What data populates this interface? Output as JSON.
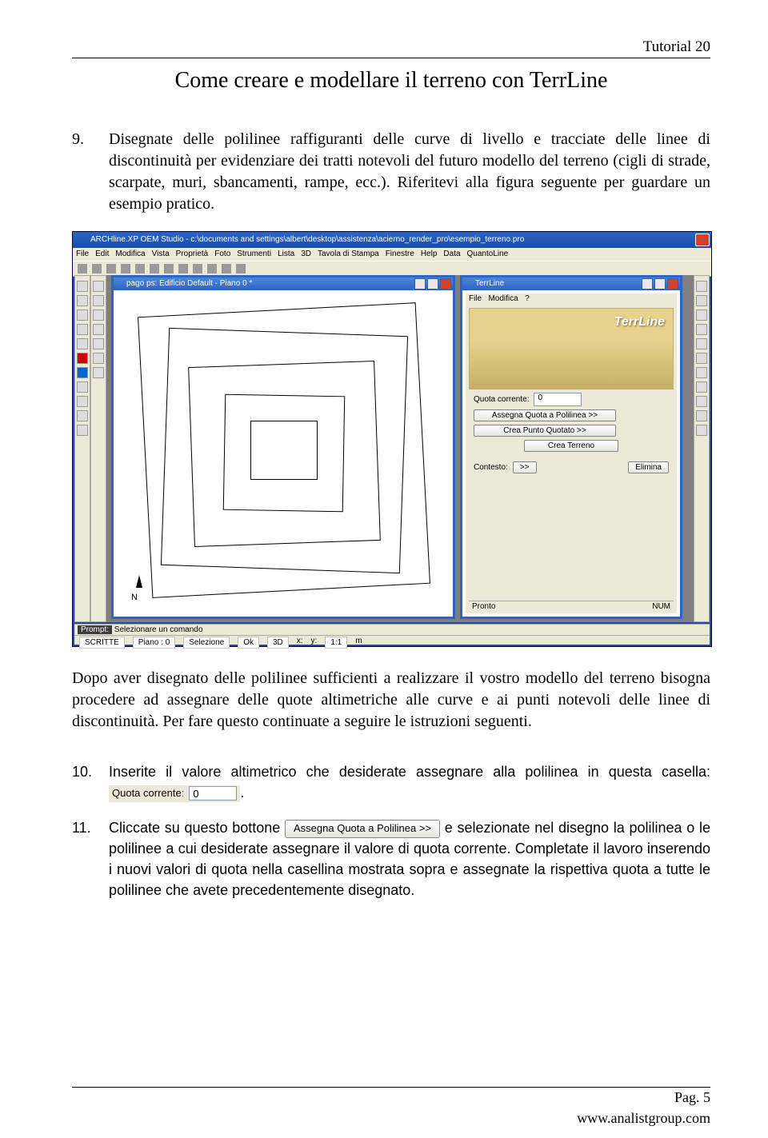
{
  "header": {
    "tutorial": "Tutorial 20"
  },
  "title": "Come creare e modellare il terreno con TerrLine",
  "step9": {
    "num": "9.",
    "text": "Disegnate delle polilinee raffiguranti delle curve di livello e tracciate delle linee di discontinuità per evidenziare dei tratti notevoli del futuro modello del terreno (cigli di strade, scarpate, muri, sbancamenti, rampe, ecc.). Riferitevi alla figura seguente per guardare un esempio pratico."
  },
  "screenshot": {
    "appTitle": "ARCHline.XP OEM Studio - c:\\documents and settings\\albert\\desktop\\assistenza\\acierno_render_pro\\esempio_terreno.pro",
    "menu": [
      "File",
      "Edit",
      "Modifica",
      "Vista",
      "Proprietà",
      "Foto",
      "Strumenti",
      "Lista",
      "3D",
      "Tavola di Stampa",
      "Finestre",
      "Help",
      "Data",
      "QuantoLine"
    ],
    "planTitle": "pago ps: Edificio Default - Piano 0 *",
    "north": "N",
    "terrline": {
      "title": "TerrLine",
      "menu": [
        "File",
        "Modifica",
        "?"
      ],
      "brand": "TerrLine",
      "quotaLabel": "Quota corrente:",
      "quotaValue": "0",
      "btnAssegna": "Assegna Quota a Polilinea >>",
      "btnCreaPunto": "Crea Punto Quotato        >>",
      "btnCreaTerreno": "Crea Terreno",
      "contestoLabel": "Contesto:",
      "btnContesto": ">>",
      "btnElimina": "Elimina",
      "statusLeft": "Pronto",
      "statusRight": "NUM"
    },
    "promptLabel": "Prompt:",
    "promptText": "Selezionare un comando",
    "status": {
      "layer": "SCRITTE",
      "piano": "Piano : 0",
      "selezione": "Selezione",
      "ok": "Ok",
      "d3": "3D",
      "x": "x:",
      "y": "y:",
      "scale": "1:1",
      "unit": "m"
    }
  },
  "afterPara": "Dopo aver disegnato delle polilinee sufficienti a realizzare il vostro modello del terreno bisogna procedere ad assegnare delle quote altimetriche alle curve e ai punti notevoli delle linee di discontinuità. Per fare questo continuate a seguire le istruzioni seguenti.",
  "step10": {
    "num": "10.",
    "pre": "Inserite il valore altimetrico che desiderate assegnare alla polilinea in questa casella: ",
    "widgetLabel": "Quota corrente:",
    "widgetValue": "0",
    "post": "."
  },
  "step11": {
    "num": "11.",
    "pre": "Cliccate su questo bottone ",
    "button": "Assegna Quota a Polilinea >>",
    "post": " e selezionate nel disegno la polilinea o le polilinee a cui desiderate assegnare il valore di quota corrente. Completate il lavoro inserendo i nuovi valori di quota nella casellina mostrata sopra e assegnate la rispettiva quota a tutte le polilinee che avete precedentemente disegnato."
  },
  "footer": {
    "page": "Pag. 5",
    "url": "www.analistgroup.com"
  }
}
